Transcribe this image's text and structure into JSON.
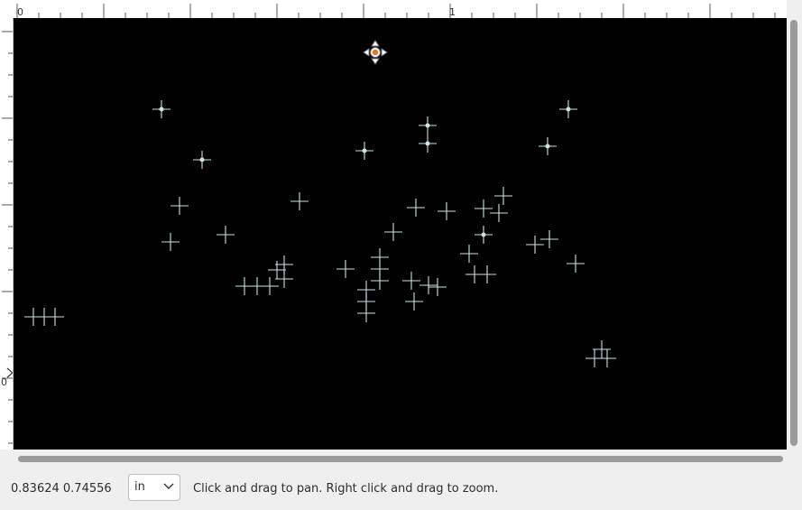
{
  "ruler": {
    "top_labels": [
      "0",
      "1"
    ],
    "left_label": "0"
  },
  "status_bar": {
    "cursor_coords": "0.83624 0.74556",
    "unit": "in",
    "hint": "Click and drag to pan. Right click and drag to zoom."
  },
  "colors": {
    "canvas_background": "#000000",
    "marker": "#c8e6e4",
    "control_point_fill": "#e07b1f"
  },
  "icons": {
    "move_cursor": "four-way-move-icon",
    "dropdown": "chevron-down-icon"
  }
}
